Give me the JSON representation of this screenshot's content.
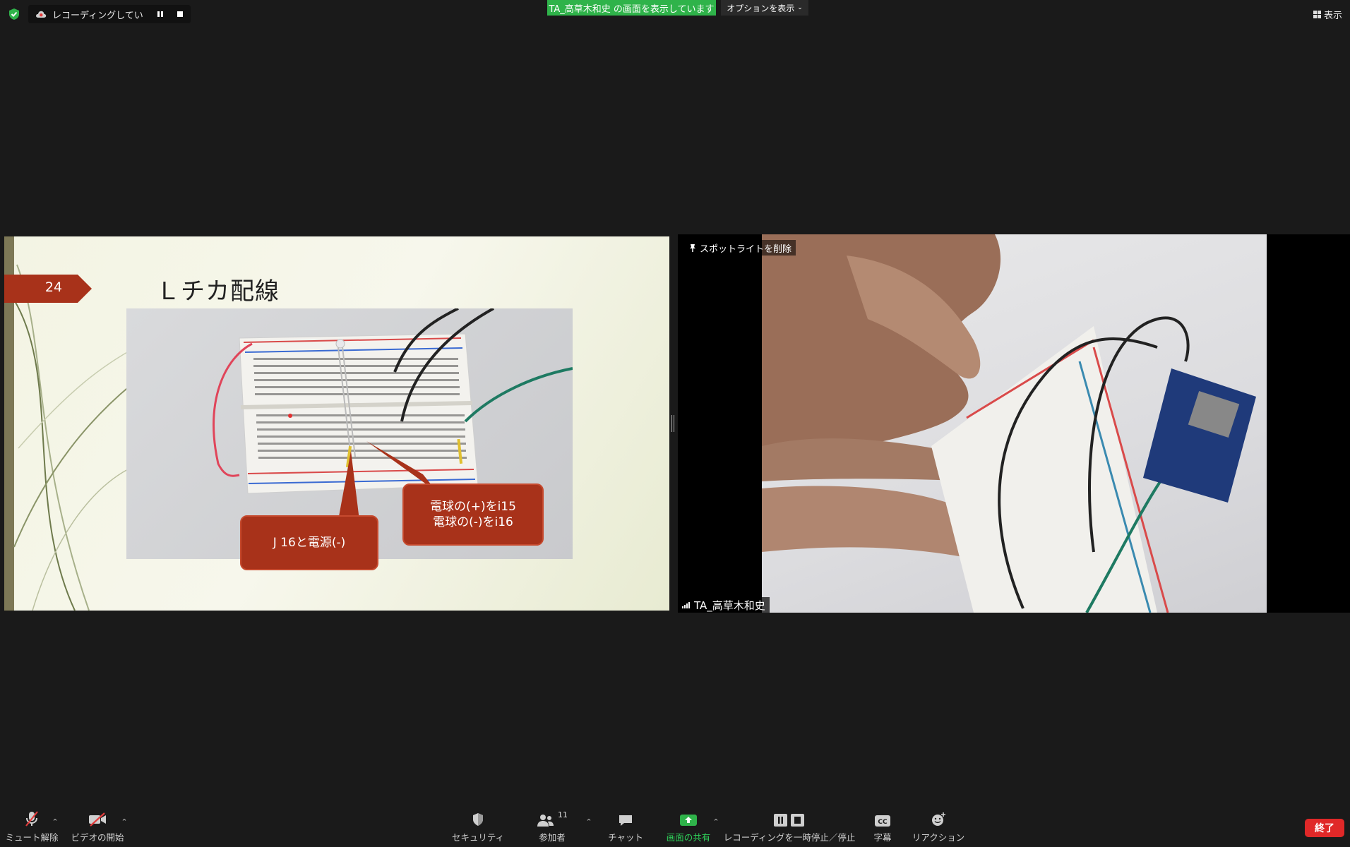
{
  "top_bar": {
    "recording_text": "レコーディングしています...",
    "share_banner": "TA_高草木和史 の画面を表示しています",
    "options_label": "オプションを表示",
    "view_label": "表示"
  },
  "slide": {
    "page_number": "24",
    "title": "Ｌチカ配線",
    "callout_1": "J 16と電源(-)",
    "callout_2_line1": "電球の(+)をi15",
    "callout_2_line2": "電球の(-)をi16"
  },
  "video": {
    "spotlight_label": "スポットライトを削除",
    "participant_name": "TA_高草木和史"
  },
  "toolbar": {
    "unmute": "ミュート解除",
    "start_video": "ビデオの開始",
    "security": "セキュリティ",
    "participants": "参加者",
    "participant_count": "11",
    "chat": "チャット",
    "share_screen": "画面の共有",
    "recording_controls": "レコーディングを一時停止／停止",
    "captions": "字幕",
    "reactions": "リアクション",
    "end": "終了"
  },
  "colors": {
    "share_green": "#2fb34a",
    "end_red": "#e02828",
    "slide_accent": "#a8321a"
  }
}
